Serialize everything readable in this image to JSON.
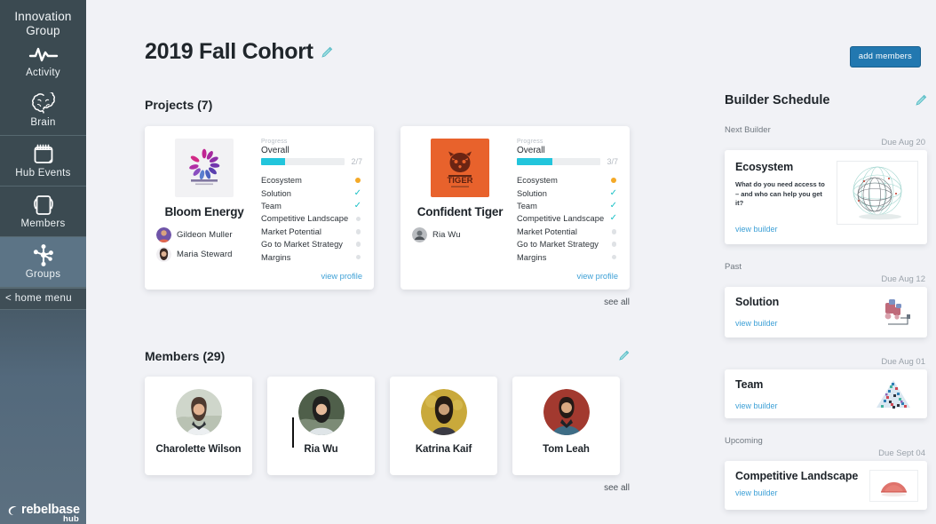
{
  "sidebar": {
    "title": "Innovation Group",
    "items": [
      {
        "label": "Activity",
        "icon": "activity-pulse-icon",
        "active": false
      },
      {
        "label": "Brain",
        "icon": "brain-icon",
        "active": false
      },
      {
        "label": "Hub Events",
        "icon": "calendar-icon",
        "active": false
      },
      {
        "label": "Members",
        "icon": "cards-icon",
        "active": false
      },
      {
        "label": "Groups",
        "icon": "network-nodes-icon",
        "active": true
      }
    ],
    "home_menu": "< home menu",
    "brand": "rebelbase",
    "brand_sub": "hub"
  },
  "header": {
    "page_title": "2019 Fall Cohort",
    "edit_icon": "pencil-icon",
    "add_members_label": "add members"
  },
  "projects": {
    "section_title": "Projects (7)",
    "see_all": "see all",
    "view_profile_label": "view profile",
    "progress_caption": "Progress",
    "overall_label": "Overall",
    "cards": [
      {
        "name": "Bloom Energy",
        "logo": "bloom-energy-logo",
        "progress_count": "2/7",
        "progress_pct": 28.5,
        "members": [
          "Gildeon Muller",
          "Maria Steward"
        ],
        "milestones": [
          {
            "label": "Ecosystem",
            "state": "current"
          },
          {
            "label": "Solution",
            "state": "done"
          },
          {
            "label": "Team",
            "state": "done"
          },
          {
            "label": "Competitive Landscape",
            "state": "todo"
          },
          {
            "label": "Market Potential",
            "state": "todo"
          },
          {
            "label": "Go to Market Strategy",
            "state": "todo"
          },
          {
            "label": "Margins",
            "state": "todo"
          }
        ]
      },
      {
        "name": "Confident Tiger",
        "logo": "confident-tiger-logo",
        "progress_count": "3/7",
        "progress_pct": 42.8,
        "members": [
          "Ria Wu"
        ],
        "milestones": [
          {
            "label": "Ecosystem",
            "state": "current"
          },
          {
            "label": "Solution",
            "state": "done"
          },
          {
            "label": "Team",
            "state": "done"
          },
          {
            "label": "Competitive Landscape",
            "state": "done"
          },
          {
            "label": "Market Potential",
            "state": "todo"
          },
          {
            "label": "Go to Market Strategy",
            "state": "todo"
          },
          {
            "label": "Margins",
            "state": "todo"
          }
        ]
      }
    ]
  },
  "members": {
    "section_title": "Members (29)",
    "edit_icon": "pencil-icon",
    "see_all": "see all",
    "cards": [
      {
        "name": "Charolette Wilson"
      },
      {
        "name": "Ria Wu"
      },
      {
        "name": "Katrina Kaif"
      },
      {
        "name": "Tom Leah"
      }
    ]
  },
  "builder_schedule": {
    "title": "Builder Schedule",
    "edit_icon": "pencil-icon",
    "groups": [
      {
        "label": "Next Builder",
        "cards": [
          {
            "title": "Ecosystem",
            "due": "Due Aug 20",
            "description": "What do you need access to – and who can help you get it?",
            "link": "view builder",
            "thumb": "wireframe-sphere-thumbnail"
          }
        ]
      },
      {
        "label": "Past",
        "cards": [
          {
            "title": "Solution",
            "due": "Due Aug 12",
            "description": "",
            "link": "view builder",
            "thumb": "machine-sketch-thumbnail"
          },
          {
            "title": "Team",
            "due": "Due Aug 01",
            "description": "",
            "link": "view builder",
            "thumb": "confetti-triangle-thumbnail"
          }
        ]
      },
      {
        "label": "Upcoming",
        "cards": [
          {
            "title": "Competitive Landscape",
            "due": "Due Sept 04",
            "description": "",
            "link": "view builder",
            "thumb": "red-fan-thumbnail"
          }
        ]
      }
    ]
  },
  "colors": {
    "accent_teal": "#22c5dc",
    "link_blue": "#3da0d6",
    "button_blue": "#2278b0",
    "milestone_orange": "#f4a927",
    "sidebar_dark": "#3b4a51",
    "sidebar_active": "#5c7486",
    "page_bg": "#f1f2f6",
    "tiger_orange": "#e8622c"
  }
}
